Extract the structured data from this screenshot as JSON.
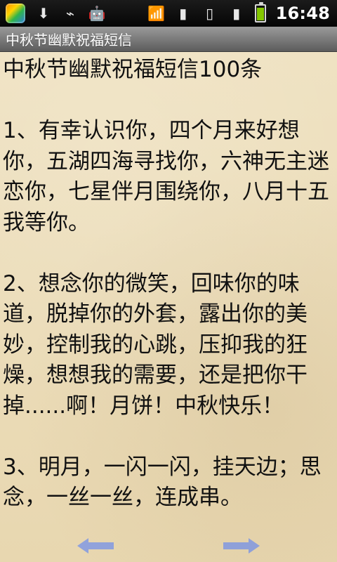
{
  "status_bar": {
    "time": "16:48",
    "colors": {
      "battery_fill": "#84c700"
    },
    "icons": [
      "app-icon",
      "download-icon",
      "usb-icon",
      "android-icon",
      "wifi-icon",
      "signal-icon",
      "sim-card-icon",
      "signal-secondary-icon",
      "battery-icon"
    ]
  },
  "title_bar": {
    "title": "中秋节幽默祝福短信"
  },
  "article": {
    "text": "中秋节幽默祝福短信100条\n\n1、有幸认识你，四个月来好想你，五湖四海寻找你，六神无主迷恋你，七星伴月围绕你，八月十五我等你。\n\n2、想念你的微笑，回味你的味道，脱掉你的外套，露出你的美妙，控制我的心跳，压抑我的狂燥，想想我的需要，还是把你干掉......啊！月饼！中秋快乐！\n\n3、明月，一闪一闪，挂天边；思念，一丝一丝，连成串。"
  },
  "bottom_nav": {
    "prev_icon": "left-arrow-icon",
    "next_icon": "right-arrow-icon",
    "color": "#4b78ff"
  }
}
